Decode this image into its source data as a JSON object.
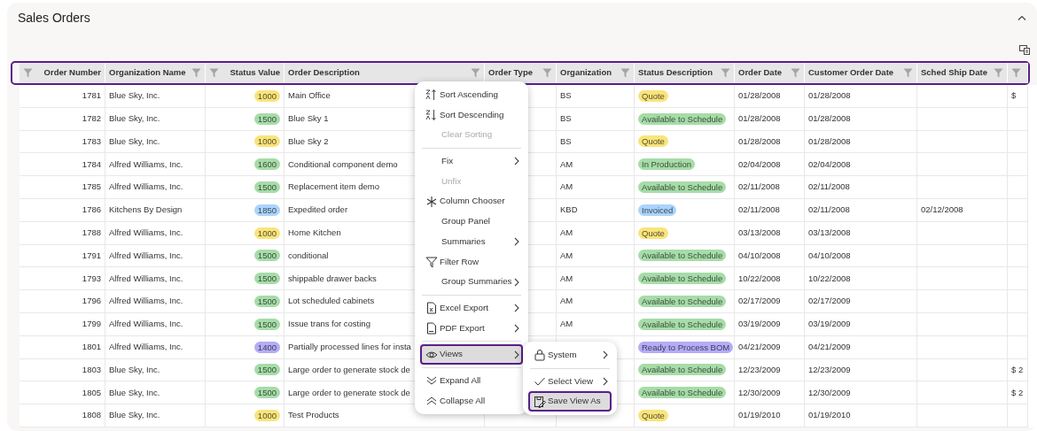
{
  "panel": {
    "title": "Sales Orders"
  },
  "columns": [
    {
      "label": "Order Number",
      "align_right": true
    },
    {
      "label": "Organization Name",
      "align_right": false
    },
    {
      "label": "Status Value",
      "align_right": true
    },
    {
      "label": "Order Description",
      "align_right": false
    },
    {
      "label": "Order Type",
      "align_right": false
    },
    {
      "label": "Organization",
      "align_right": false
    },
    {
      "label": "Status Description",
      "align_right": false
    },
    {
      "label": "Order Date",
      "align_right": false
    },
    {
      "label": "Customer Order Date",
      "align_right": false
    },
    {
      "label": "Sched Ship Date",
      "align_right": false
    },
    {}
  ],
  "rows": [
    {
      "order_number": "1781",
      "organization_name": "Blue Sky, Inc.",
      "status_value": {
        "text": "1000",
        "color": "#f9e47c"
      },
      "order_description": "Main Office",
      "organization": "BS",
      "status_description": {
        "text": "Quote",
        "color": "#f9e47c"
      },
      "order_date": "01/28/2008",
      "customer_order_date": "01/28/2008",
      "column_11": "$"
    },
    {
      "order_number": "1782",
      "organization_name": "Blue Sky, Inc.",
      "status_value": {
        "text": "1500",
        "color": "#a6dca8"
      },
      "order_description": "Blue Sky 1",
      "organization": "BS",
      "status_description": {
        "text": "Available to Schedule",
        "color": "#a6dca8"
      },
      "order_date": "01/28/2008",
      "customer_order_date": "01/28/2008"
    },
    {
      "order_number": "1783",
      "organization_name": "Blue Sky, Inc.",
      "status_value": {
        "text": "1000",
        "color": "#f9e47c"
      },
      "order_description": "Blue Sky 2",
      "organization": "BS",
      "status_description": {
        "text": "Quote",
        "color": "#f9e47c"
      },
      "order_date": "01/28/2008",
      "customer_order_date": "01/28/2008"
    },
    {
      "order_number": "1784",
      "organization_name": "Alfred Williams, Inc.",
      "status_value": {
        "text": "1600",
        "color": "#a6dca8"
      },
      "order_description": "Conditional component demo",
      "organization": "AM",
      "status_description": {
        "text": "In Production",
        "color": "#a6dca8"
      },
      "order_date": "02/04/2008",
      "customer_order_date": "02/04/2008"
    },
    {
      "order_number": "1785",
      "organization_name": "Alfred Williams, Inc.",
      "status_value": {
        "text": "1500",
        "color": "#a6dca8"
      },
      "order_description": "Replacement item demo",
      "organization": "AM",
      "status_description": {
        "text": "Available to Schedule",
        "color": "#a6dca8"
      },
      "order_date": "02/11/2008",
      "customer_order_date": "02/11/2008"
    },
    {
      "order_number": "1786",
      "organization_name": "Kitchens By Design",
      "status_value": {
        "text": "1850",
        "color": "#aad4fb"
      },
      "order_description": "Expedited order",
      "organization": "KBD",
      "status_description": {
        "text": "Invoiced",
        "color": "#aad4fb"
      },
      "order_date": "02/11/2008",
      "customer_order_date": "02/11/2008",
      "sched_ship_date": "02/12/2008"
    },
    {
      "order_number": "1788",
      "organization_name": "Alfred Williams, Inc.",
      "status_value": {
        "text": "1000",
        "color": "#f9e47c"
      },
      "order_description": "Home Kitchen",
      "organization": "AM",
      "status_description": {
        "text": "Quote",
        "color": "#f9e47c"
      },
      "order_date": "03/13/2008",
      "customer_order_date": "03/13/2008"
    },
    {
      "order_number": "1791",
      "organization_name": "Alfred Williams, Inc.",
      "status_value": {
        "text": "1500",
        "color": "#a6dca8"
      },
      "order_description": "conditional",
      "organization": "AM",
      "status_description": {
        "text": "Available to Schedule",
        "color": "#a6dca8"
      },
      "order_date": "04/10/2008",
      "customer_order_date": "04/10/2008"
    },
    {
      "order_number": "1793",
      "organization_name": "Alfred Williams, Inc.",
      "status_value": {
        "text": "1500",
        "color": "#a6dca8"
      },
      "order_description": "shippable drawer backs",
      "organization": "AM",
      "status_description": {
        "text": "Available to Schedule",
        "color": "#a6dca8"
      },
      "order_date": "10/22/2008",
      "customer_order_date": "10/22/2008"
    },
    {
      "order_number": "1796",
      "organization_name": "Alfred Williams, Inc.",
      "status_value": {
        "text": "1500",
        "color": "#a6dca8"
      },
      "order_description": "Lot scheduled cabinets",
      "organization": "AM",
      "status_description": {
        "text": "Available to Schedule",
        "color": "#a6dca8"
      },
      "order_date": "02/17/2009",
      "customer_order_date": "02/17/2009"
    },
    {
      "order_number": "1799",
      "organization_name": "Alfred Williams, Inc.",
      "status_value": {
        "text": "1500",
        "color": "#a6dca8"
      },
      "order_description": "Issue trans for costing",
      "organization": "AM",
      "status_description": {
        "text": "Available to Schedule",
        "color": "#a6dca8"
      },
      "order_date": "03/19/2009",
      "customer_order_date": "03/19/2009"
    },
    {
      "order_number": "1801",
      "organization_name": "Alfred Williams, Inc.",
      "status_value": {
        "text": "1400",
        "color": "#b4acf6"
      },
      "order_description": "Partially processed lines for insta",
      "status_description": {
        "text": "Ready to Process BOM",
        "color": "#b4acf6"
      },
      "order_date": "04/21/2009",
      "customer_order_date": "04/21/2009"
    },
    {
      "order_number": "1803",
      "organization_name": "Blue Sky, Inc.",
      "status_value": {
        "text": "1500",
        "color": "#a6dca8"
      },
      "order_description": "Large order to generate stock de",
      "status_description": {
        "text": "Available to Schedule",
        "color": "#a6dca8"
      },
      "order_date": "12/23/2009",
      "customer_order_date": "12/23/2009",
      "column_11": "$ 2"
    },
    {
      "order_number": "1805",
      "organization_name": "Blue Sky, Inc.",
      "status_value": {
        "text": "1500",
        "color": "#a6dca8"
      },
      "order_description": "Large order to generate stock de",
      "status_description": {
        "text": "Available to Schedule",
        "color": "#a6dca8"
      },
      "order_date": "12/30/2009",
      "customer_order_date": "12/30/2009",
      "column_11": "$ 2"
    },
    {
      "order_number": "1808",
      "organization_name": "Blue Sky, Inc.",
      "status_value": {
        "text": "1000",
        "color": "#f9e47c"
      },
      "order_description": "Test Products",
      "status_description": {
        "text": "Quote",
        "color": "#f9e47c"
      },
      "order_date": "01/19/2010",
      "customer_order_date": "01/19/2010"
    }
  ],
  "column_menu": {
    "items": [
      {
        "kind": "item",
        "label": "Sort Ascending",
        "disabled": false,
        "submenu": false,
        "selected": false
      },
      {
        "kind": "item",
        "label": "Sort Descending",
        "disabled": false,
        "submenu": false,
        "selected": false
      },
      {
        "kind": "item",
        "label": "Clear Sorting",
        "disabled": true,
        "submenu": false,
        "selected": false
      },
      {
        "kind": "divider"
      },
      {
        "kind": "item",
        "label": "Fix",
        "disabled": false,
        "submenu": true,
        "selected": false
      },
      {
        "kind": "item",
        "label": "Unfix",
        "disabled": true,
        "submenu": false,
        "selected": false
      },
      {
        "kind": "item",
        "label": "Column Chooser",
        "disabled": false,
        "submenu": false,
        "selected": false
      },
      {
        "kind": "item",
        "label": "Group Panel",
        "disabled": false,
        "submenu": false,
        "selected": false
      },
      {
        "kind": "item",
        "label": "Summaries",
        "disabled": false,
        "submenu": true,
        "selected": false
      },
      {
        "kind": "item",
        "label": "Filter Row",
        "disabled": false,
        "submenu": false,
        "selected": false
      },
      {
        "kind": "item",
        "label": "Group Summaries",
        "disabled": false,
        "submenu": true,
        "selected": false
      },
      {
        "kind": "divider"
      },
      {
        "kind": "item",
        "label": "Excel Export",
        "disabled": false,
        "submenu": true,
        "selected": false
      },
      {
        "kind": "item",
        "label": "PDF Export",
        "disabled": false,
        "submenu": true,
        "selected": false
      },
      {
        "kind": "divider"
      },
      {
        "kind": "item",
        "label": "Views",
        "disabled": false,
        "submenu": true,
        "selected": true
      },
      {
        "kind": "divider"
      },
      {
        "kind": "item",
        "label": "Expand All",
        "disabled": false,
        "submenu": false,
        "selected": false
      },
      {
        "kind": "item",
        "label": "Collapse All",
        "disabled": false,
        "submenu": false,
        "selected": false
      }
    ]
  },
  "views_submenu": {
    "items": [
      {
        "kind": "item",
        "label": "System",
        "disabled": false,
        "submenu": true,
        "selected": false
      },
      {
        "kind": "divider"
      },
      {
        "kind": "item",
        "label": "Select View",
        "disabled": false,
        "submenu": true,
        "selected": false
      },
      {
        "kind": "item",
        "label": "Save View As",
        "disabled": false,
        "submenu": false,
        "selected": true
      }
    ]
  }
}
